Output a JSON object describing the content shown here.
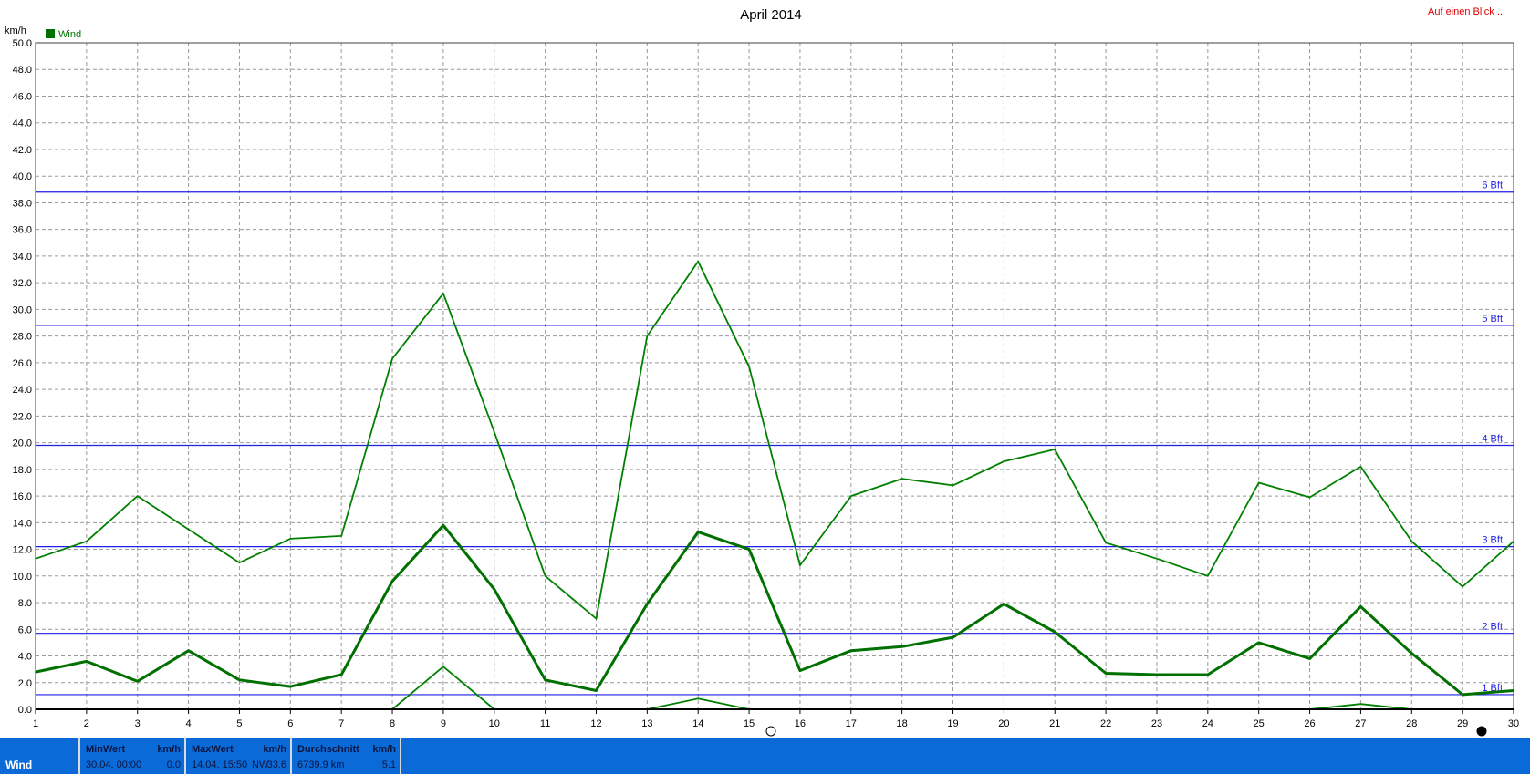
{
  "chart_data": {
    "type": "line",
    "title": "April 2014",
    "ylabel": "km/h",
    "legend": {
      "label": "Wind",
      "color": "#007000",
      "placement": "top-left"
    },
    "ylim": [
      0,
      50
    ],
    "yticks": [
      "0.0",
      "2.0",
      "4.0",
      "6.0",
      "8.0",
      "10.0",
      "12.0",
      "14.0",
      "16.0",
      "18.0",
      "20.0",
      "22.0",
      "24.0",
      "26.0",
      "28.0",
      "30.0",
      "32.0",
      "34.0",
      "36.0",
      "38.0",
      "40.0",
      "42.0",
      "44.0",
      "46.0",
      "48.0",
      "50.0"
    ],
    "x": [
      1,
      2,
      3,
      4,
      5,
      6,
      7,
      8,
      9,
      10,
      11,
      12,
      13,
      14,
      15,
      16,
      17,
      18,
      19,
      20,
      21,
      22,
      23,
      24,
      25,
      26,
      27,
      28,
      29,
      30
    ],
    "grid": true,
    "series": [
      {
        "role": "max",
        "color": "#008000",
        "values": [
          11.3,
          12.6,
          16.0,
          13.5,
          11.0,
          12.8,
          13.0,
          26.3,
          31.2,
          20.8,
          10.0,
          6.8,
          28.0,
          33.6,
          25.7,
          10.8,
          16.0,
          17.3,
          16.8,
          18.6,
          19.5,
          12.5,
          11.3,
          10.0,
          17.0,
          15.9,
          18.2,
          12.6,
          9.2,
          12.6
        ]
      },
      {
        "role": "average",
        "color": "#007000",
        "values": [
          2.8,
          3.6,
          2.1,
          4.4,
          2.2,
          1.7,
          2.6,
          9.6,
          13.8,
          9.0,
          2.2,
          1.4,
          7.9,
          13.3,
          12.0,
          2.9,
          4.4,
          4.7,
          5.4,
          7.9,
          5.8,
          2.7,
          2.6,
          2.6,
          5.0,
          3.8,
          7.7,
          4.2,
          1.1,
          1.4
        ]
      },
      {
        "role": "min",
        "color": "#008000",
        "values": [
          0,
          0,
          0,
          0,
          0,
          0,
          0,
          0,
          3.2,
          0,
          0,
          0,
          0,
          0.8,
          0,
          0,
          0,
          0,
          0,
          0,
          0,
          0,
          0,
          0,
          0,
          0,
          0.4,
          0,
          0,
          0
        ]
      }
    ],
    "reference_lines": [
      {
        "label": "1 Bft",
        "value": 1.1
      },
      {
        "label": "2 Bft",
        "value": 5.7
      },
      {
        "label": "3 Bft",
        "value": 12.2
      },
      {
        "label": "4 Bft",
        "value": 19.8
      },
      {
        "label": "5 Bft",
        "value": 28.8
      },
      {
        "label": "6 Bft",
        "value": 38.8
      }
    ]
  },
  "header": {
    "link": "Auf einen Blick ..."
  },
  "colors": {
    "ref_line": "#1f1fe6",
    "footer_bg": "#0a6ad8",
    "link": "#e00000"
  },
  "footer": {
    "name": "Wind",
    "cells": [
      {
        "header": "MinWert",
        "unit": "km/h",
        "date": "30.04.  00:00",
        "value": "0.0"
      },
      {
        "header": "MaxWert",
        "unit": "km/h",
        "date": "14.04.  15:50",
        "extra": "NW",
        "value": "33.6"
      },
      {
        "header": "Durchschnitt",
        "unit": "km/h",
        "date": "6739.9 km",
        "value": "5.1"
      }
    ]
  }
}
